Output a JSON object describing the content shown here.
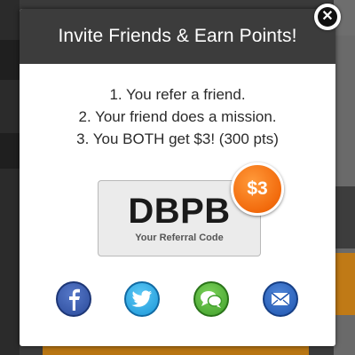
{
  "modal": {
    "title": "Invite Friends & Earn Points!",
    "steps": [
      "1. You refer a friend.",
      "2. Your friend does a mission.",
      "3. You BOTH get $3! (300 pts)"
    ],
    "referral_code": "DBPB",
    "referral_caption": "Your Referral Code",
    "reward_badge": "$3"
  },
  "share": [
    {
      "name": "facebook",
      "icon": "facebook-icon"
    },
    {
      "name": "twitter",
      "icon": "twitter-icon"
    },
    {
      "name": "sms",
      "icon": "chat-bubbles-icon"
    },
    {
      "name": "email",
      "icon": "envelope-icon"
    }
  ],
  "close": {
    "icon": "close-icon",
    "glyph": "✕"
  },
  "colors": {
    "header_bg": "#3c3c3c",
    "badge_orange": "#f26a0c",
    "facebook_blue": "#2b4b9b",
    "twitter_blue": "#1b97d8",
    "sms_green": "#3f9e2a",
    "email_blue": "#1f55b0"
  }
}
